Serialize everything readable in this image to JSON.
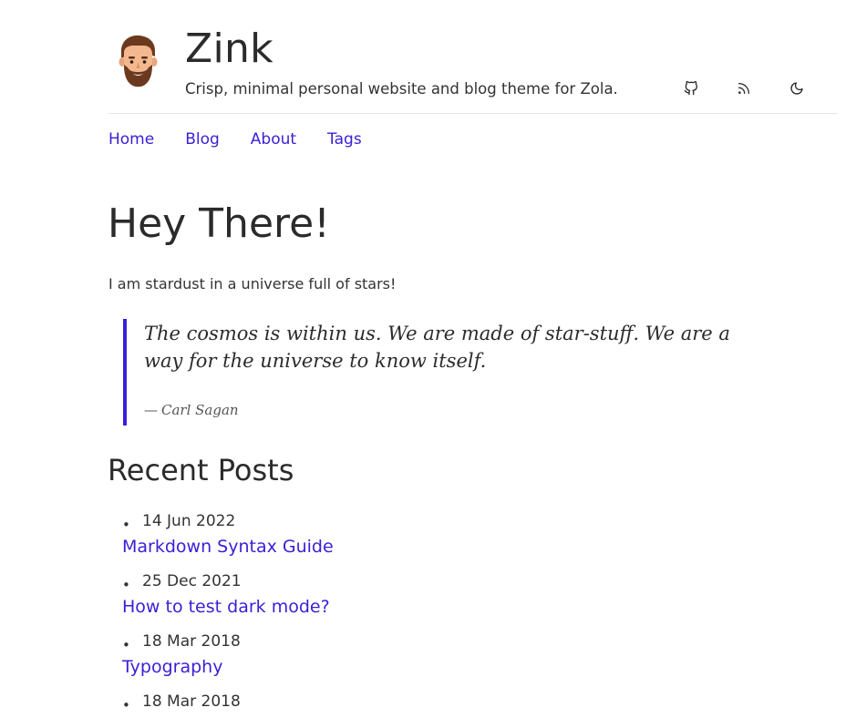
{
  "site": {
    "title": "Zink",
    "tagline": "Crisp, minimal personal website and blog theme for Zola.",
    "avatar_icon": "bearded-man-avatar",
    "header_icons": [
      "github-icon",
      "rss-icon",
      "moon-icon"
    ]
  },
  "nav": {
    "items": [
      {
        "label": "Home"
      },
      {
        "label": "Blog"
      },
      {
        "label": "About"
      },
      {
        "label": "Tags"
      }
    ]
  },
  "main": {
    "heading": "Hey There!",
    "intro": "I am stardust in a universe full of stars!",
    "quote": {
      "text": "The cosmos is within us. We are made of star-stuff. We are a way for the universe to know itself.",
      "dash": "—",
      "author": "Carl Sagan"
    },
    "recent_heading": "Recent Posts",
    "posts": [
      {
        "date": "14 Jun 2022",
        "title": "Markdown Syntax Guide"
      },
      {
        "date": "25 Dec 2021",
        "title": "How to test dark mode?"
      },
      {
        "date": "18 Mar 2018",
        "title": "Typography"
      },
      {
        "date": "18 Mar 2018",
        "title": ""
      }
    ]
  },
  "colors": {
    "accent": "#3a1fd6",
    "text": "#2b2b2b",
    "divider": "#e6e6e6"
  }
}
